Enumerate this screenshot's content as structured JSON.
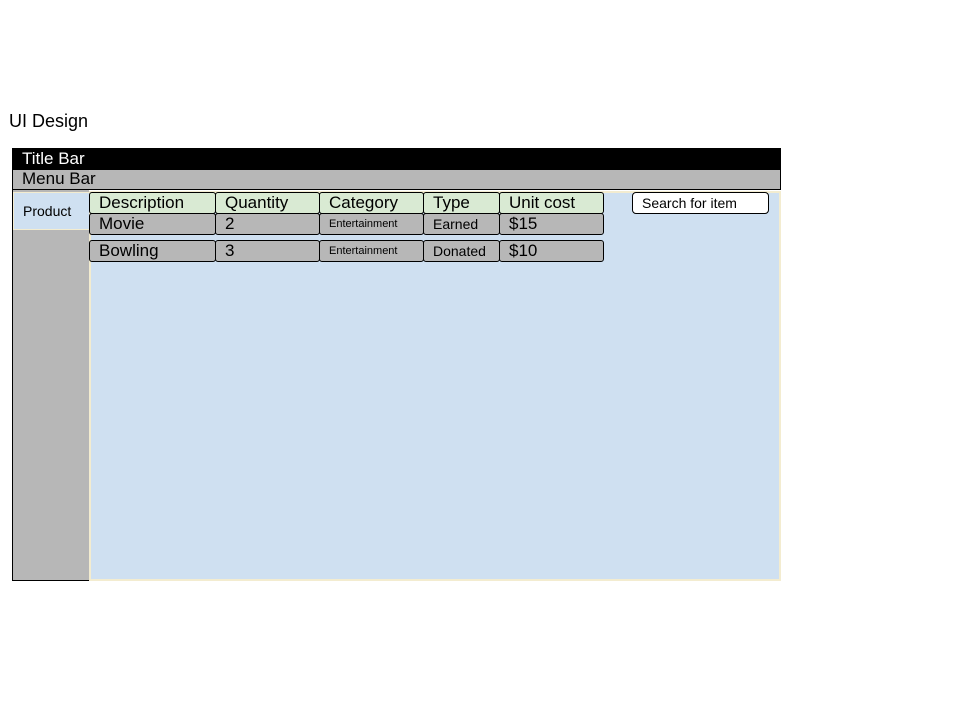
{
  "page": {
    "heading": "UI Design"
  },
  "window": {
    "title_bar": "Title Bar",
    "menu_bar": "Menu Bar"
  },
  "sidebar": {
    "items": [
      {
        "label": "Product"
      }
    ]
  },
  "table": {
    "headers": [
      "Description",
      "Quantity",
      "Category",
      "Type",
      "Unit cost"
    ],
    "rows": [
      [
        "Movie",
        "2",
        "Entertainment",
        "Earned",
        "$15"
      ],
      [
        "Bowling",
        "3",
        "Entertainment",
        "Donated",
        "$10"
      ]
    ]
  },
  "search": {
    "placeholder": "Search for item"
  },
  "colors": {
    "title_bar_bg": "#000000",
    "bar_gray": "#b7b7b7",
    "content_bg": "#cfe0f1",
    "header_bg": "#d9ead3",
    "border_cream": "#f3ecd0"
  }
}
